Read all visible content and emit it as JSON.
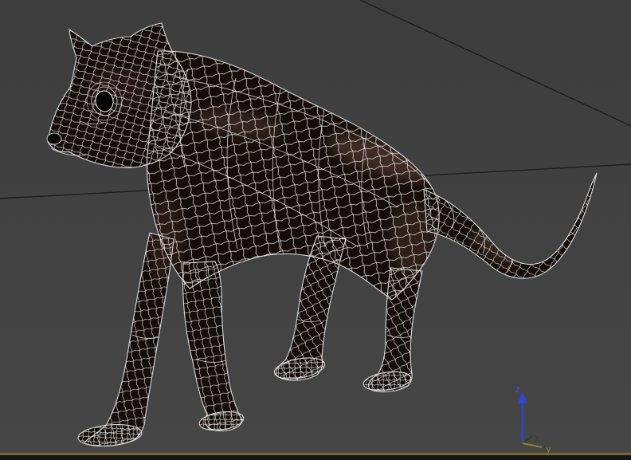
{
  "viewport": {
    "background_color": "#414141",
    "grid": {
      "diagonal_line_color": "#1e1e1e",
      "ground_line_color": "#77662a",
      "bottom_edge_color": "#161616"
    },
    "model": {
      "surface_color": "#150d0a",
      "wireframe_color": "#e9e9e9"
    },
    "axis_gizmo": {
      "z": {
        "label": "z",
        "color": "#3a55e8"
      },
      "x": {
        "label": "x",
        "color": "#2a4a22"
      },
      "y": {
        "label": "y",
        "color": "#8f8426"
      }
    }
  }
}
